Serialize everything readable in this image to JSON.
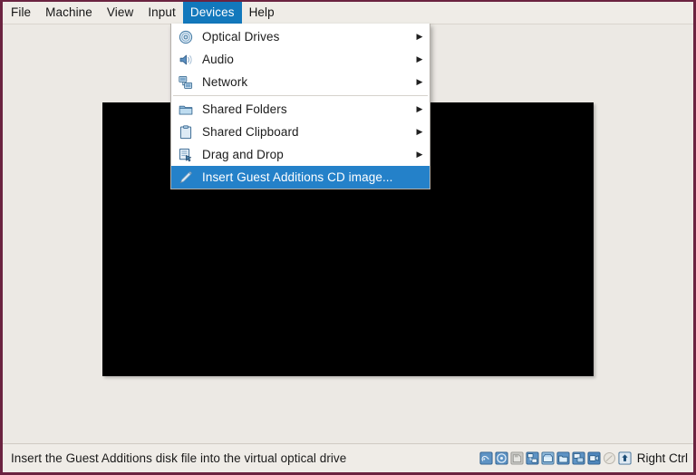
{
  "window": {
    "frame_color": "#6b2340",
    "background": "#ece9e4"
  },
  "menubar": {
    "accent_color": "#1278bc",
    "items": [
      {
        "label": "File",
        "active": false
      },
      {
        "label": "Machine",
        "active": false
      },
      {
        "label": "View",
        "active": false
      },
      {
        "label": "Input",
        "active": false
      },
      {
        "label": "Devices",
        "active": true
      },
      {
        "label": "Help",
        "active": false
      }
    ]
  },
  "devices_menu": {
    "open": true,
    "highlight_color": "#2481c9",
    "items": [
      {
        "label": "Optical Drives",
        "icon": "optical-drive-icon",
        "submenu": true,
        "selected": false,
        "separator_after": false
      },
      {
        "label": "Audio",
        "icon": "audio-icon",
        "submenu": true,
        "selected": false,
        "separator_after": false
      },
      {
        "label": "Network",
        "icon": "network-icon",
        "submenu": true,
        "selected": false,
        "separator_after": true
      },
      {
        "label": "Shared Folders",
        "icon": "shared-folders-icon",
        "submenu": true,
        "selected": false,
        "separator_after": false
      },
      {
        "label": "Shared Clipboard",
        "icon": "shared-clipboard-icon",
        "submenu": true,
        "selected": false,
        "separator_after": false
      },
      {
        "label": "Drag and Drop",
        "icon": "drag-and-drop-icon",
        "submenu": true,
        "selected": false,
        "separator_after": false
      },
      {
        "label": "Insert Guest Additions CD image...",
        "icon": "guest-additions-cd-icon",
        "submenu": false,
        "selected": true,
        "separator_after": false
      }
    ]
  },
  "vm_screen": {
    "color": "#000000"
  },
  "statusbar": {
    "message": "Insert the Guest Additions disk file into the virtual optical drive",
    "host_key_label": "Right Ctrl",
    "indicators": [
      {
        "name": "hard-disk-indicator"
      },
      {
        "name": "optical-disk-indicator"
      },
      {
        "name": "floppy-disk-indicator"
      },
      {
        "name": "network-indicator"
      },
      {
        "name": "usb-indicator"
      },
      {
        "name": "shared-folders-indicator"
      },
      {
        "name": "display-indicator"
      },
      {
        "name": "recording-indicator"
      },
      {
        "name": "features-indicator"
      },
      {
        "name": "mouse-integration-indicator"
      }
    ]
  }
}
